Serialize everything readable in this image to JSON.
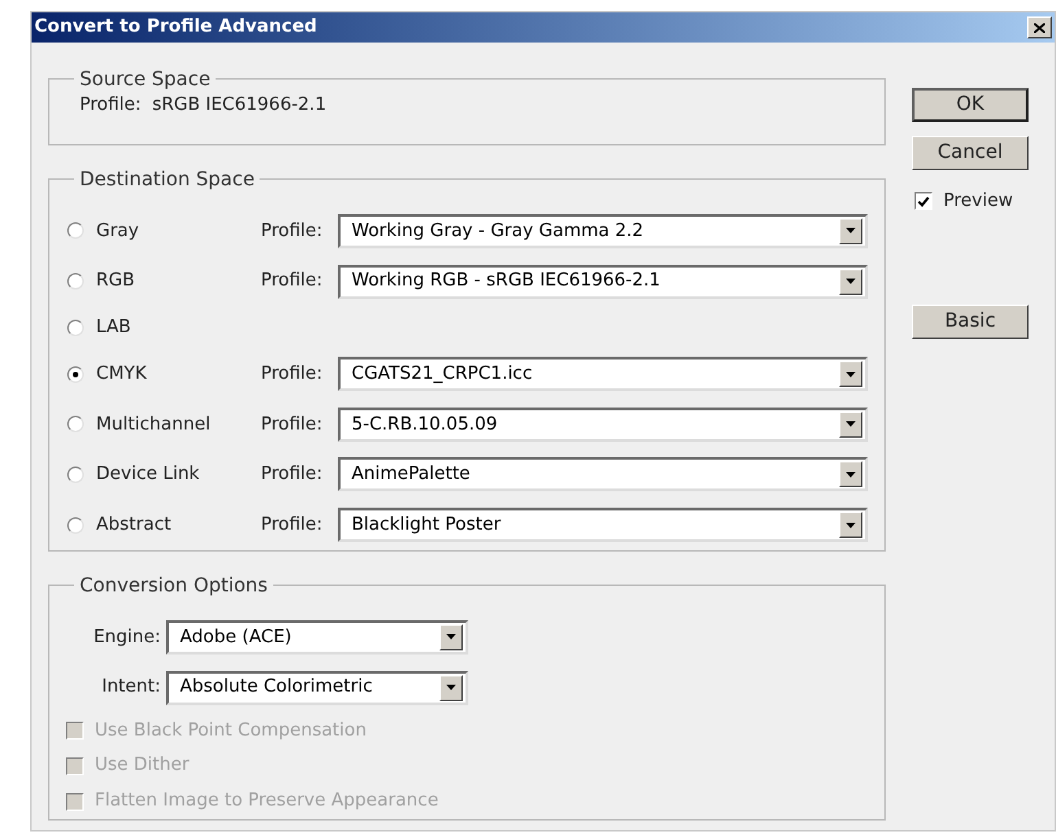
{
  "window": {
    "title": "Convert to Profile Advanced"
  },
  "source_space": {
    "legend": "Source Space",
    "profile_label": "Profile:",
    "profile": "sRGB IEC61966-2.1"
  },
  "destination_space": {
    "legend": "Destination Space",
    "options": [
      {
        "label": "Gray",
        "selected": false,
        "profile_label": "Profile:",
        "profile": "Working Gray - Gray Gamma 2.2"
      },
      {
        "label": "RGB",
        "selected": false,
        "profile_label": "Profile:",
        "profile": "Working RGB - sRGB IEC61966-2.1"
      },
      {
        "label": "LAB",
        "selected": false
      },
      {
        "label": "CMYK",
        "selected": true,
        "profile_label": "Profile:",
        "profile": "CGATS21_CRPC1.icc"
      },
      {
        "label": "Multichannel",
        "selected": false,
        "profile_label": "Profile:",
        "profile": "5-C.RB.10.05.09"
      },
      {
        "label": "Device Link",
        "selected": false,
        "profile_label": "Profile:",
        "profile": "AnimePalette"
      },
      {
        "label": "Abstract",
        "selected": false,
        "profile_label": "Profile:",
        "profile": "Blacklight Poster"
      }
    ]
  },
  "conversion_options": {
    "legend": "Conversion Options",
    "selects": [
      {
        "label": "Engine:",
        "value": "Adobe (ACE)"
      },
      {
        "label": "Intent:",
        "value": "Absolute Colorimetric"
      }
    ],
    "checkboxes": [
      {
        "label": "Use Black Point Compensation",
        "checked": false,
        "disabled": true
      },
      {
        "label": "Use Dither",
        "checked": false,
        "disabled": true
      },
      {
        "label": "Flatten Image to Preserve Appearance",
        "checked": false,
        "disabled": true
      }
    ]
  },
  "buttons": [
    {
      "label": "OK",
      "default": true
    },
    {
      "label": "Cancel",
      "default": false
    }
  ],
  "preview": {
    "label": "Preview",
    "checked": true,
    "disabled": false
  },
  "basic_button": {
    "label": "Basic"
  }
}
